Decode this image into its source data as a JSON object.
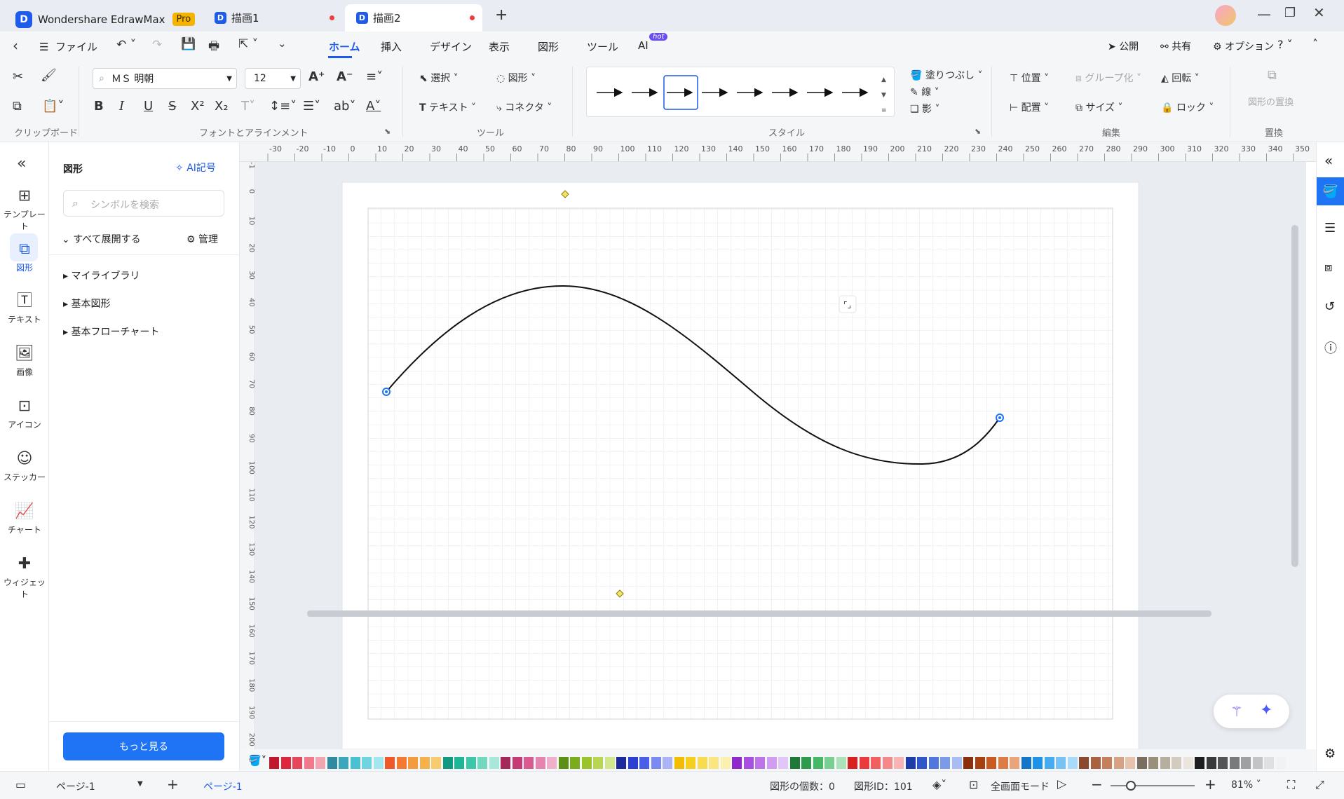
{
  "app": {
    "name": "Wondershare EdrawMax",
    "badge": "Pro"
  },
  "tabs": [
    {
      "label": "描画1"
    },
    {
      "label": "描画2"
    }
  ],
  "menubar": {
    "file": "ファイル",
    "items": [
      "ホーム",
      "挿入",
      "デザイン",
      "表示",
      "図形",
      "ツール",
      "AI"
    ],
    "ai_badge": "hot",
    "publish": "公開",
    "share": "共有",
    "options": "オプション"
  },
  "ribbon": {
    "font_name": "ＭＳ 明朝",
    "font_size": "12",
    "select": "選択",
    "shape": "図形",
    "text": "テキスト",
    "connector": "コネクタ",
    "fill": "塗りつぶし",
    "line": "線",
    "shadow": "影",
    "position": "位置",
    "group": "グループ化",
    "rotate": "回転",
    "align": "配置",
    "size": "サイズ",
    "lock": "ロック",
    "replace_shape": "図形の置換",
    "groups": {
      "clipboard": "クリップボード",
      "font": "フォントとアラインメント",
      "tools": "ツール",
      "style": "スタイル",
      "edit": "編集",
      "replace": "置換"
    }
  },
  "leftbar": [
    {
      "label": "テンプレート",
      "icon": "template-icon"
    },
    {
      "label": "図形",
      "icon": "shapes-icon"
    },
    {
      "label": "テキスト",
      "icon": "text-icon"
    },
    {
      "label": "画像",
      "icon": "image-icon"
    },
    {
      "label": "アイコン",
      "icon": "icon-icon"
    },
    {
      "label": "ステッカー",
      "icon": "sticker-icon"
    },
    {
      "label": "チャート",
      "icon": "chart-icon"
    },
    {
      "label": "ウィジェット",
      "icon": "widget-icon"
    }
  ],
  "panel": {
    "title": "図形",
    "ai_symbol": "AI記号",
    "search_placeholder": "シンボルを検索",
    "expand_all": "すべて展開する",
    "manage": "管理",
    "libraries": [
      "マイライブラリ",
      "基本図形",
      "基本フローチャート"
    ],
    "more": "もっと見る"
  },
  "ruler_top": [
    "-30",
    "-20",
    "-10",
    "0",
    "10",
    "20",
    "30",
    "40",
    "50",
    "60",
    "70",
    "80",
    "90",
    "100",
    "110",
    "120",
    "130",
    "140",
    "150",
    "160",
    "170",
    "180",
    "190",
    "200",
    "210",
    "220",
    "230",
    "240",
    "250",
    "260",
    "270",
    "280",
    "290",
    "300",
    "310",
    "320",
    "330",
    "340",
    "350"
  ],
  "ruler_left": [
    "-1",
    "0",
    "10",
    "20",
    "30",
    "40",
    "50",
    "60",
    "70",
    "80",
    "90",
    "100",
    "110",
    "120",
    "130",
    "140",
    "150",
    "160",
    "170",
    "180",
    "190",
    "200"
  ],
  "status": {
    "page_select": "ページ-1",
    "page_tab": "ページ-1",
    "shape_count": "図形の個数：0",
    "shape_id": "図形ID：101",
    "fullscreen": "全画面モード",
    "zoom": "81%"
  },
  "colors": {
    "accent": "#1e5bea",
    "palette": [
      "#c0182f",
      "#e0263c",
      "#e6455a",
      "#f07a8c",
      "#f3a4b1",
      "#2e8ba0",
      "#3aa7bd",
      "#49c0d3",
      "#6fd3e1",
      "#a3e6ee",
      "#f0582a",
      "#f47a34",
      "#f59a3d",
      "#f6b24a",
      "#f8cb6e",
      "#129a80",
      "#1fb597",
      "#3cc7a9",
      "#73d8c0",
      "#a9e8d8",
      "#a3285c",
      "#c63a75",
      "#d95a91",
      "#e584ae",
      "#f0afcb",
      "#5c8f16",
      "#7aad1c",
      "#9bc42b",
      "#b8d653",
      "#d3e68b",
      "#1c2a9e",
      "#2b3fd0",
      "#4a5ee6",
      "#7a8af0",
      "#a9b3f6",
      "#f2bd00",
      "#f6cf1e",
      "#f8dc4f",
      "#fae67f",
      "#fcf0b0",
      "#8e2ac9",
      "#a84ee0",
      "#bd74ea",
      "#d09ef1",
      "#e2c6f7",
      "#1f7a3a",
      "#2e9a4c",
      "#45b766",
      "#79ce91",
      "#ace2b9",
      "#d92020",
      "#e93b3b",
      "#f06060",
      "#f58989",
      "#f9b3b3",
      "#1f3da8",
      "#2f57c9",
      "#4f77de",
      "#7b9aea",
      "#a8bdf3",
      "#8a2f0b",
      "#a8400f",
      "#c85a22",
      "#dc7c47",
      "#e9a47c",
      "#1576c9",
      "#1e92e6",
      "#47abf0",
      "#77c3f5",
      "#a8daf9",
      "#8b4a2b",
      "#a96340",
      "#c4805d",
      "#d7a184",
      "#e7c3ae",
      "#7a6f5e",
      "#9a8f7d",
      "#b8ae9d",
      "#d3cbbd",
      "#ebe6dd",
      "#1e1e1e",
      "#3a3a3a",
      "#555555",
      "#7a7a7a",
      "#a0a0a0",
      "#c4c4c4",
      "#e0e0e0",
      "#f2f2f2"
    ]
  }
}
